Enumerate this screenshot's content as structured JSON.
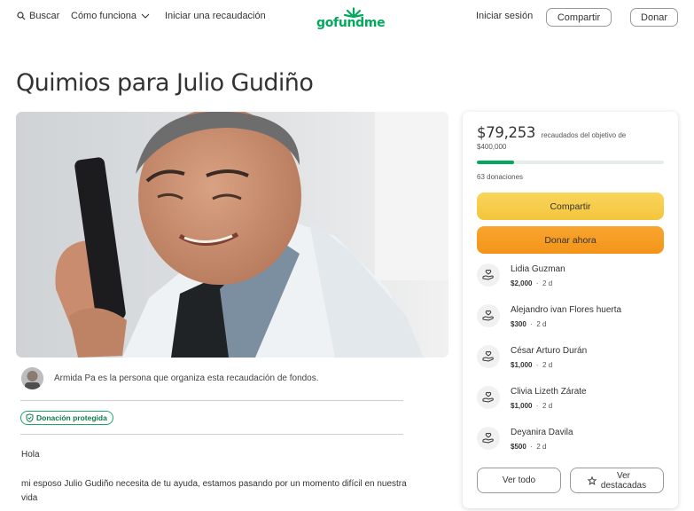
{
  "header": {
    "search_label": "Buscar",
    "how_label": "Cómo funciona",
    "start_label": "Iniciar una recaudación",
    "logo_text": "gofundme",
    "login_label": "Iniciar sesión",
    "share_label": "Compartir",
    "donate_label": "Donar"
  },
  "campaign": {
    "title": "Quimios para Julio Gudiño",
    "organizer_text": "Armida Pa es la persona que organiza esta recaudación de fondos.",
    "badge_label": "Donación protegida",
    "story": [
      "Hola",
      "mi esposo Julio Gudiño necesita de tu ayuda, estamos pasando por un momento difícil en nuestra vida"
    ]
  },
  "card": {
    "raised_amount": "$79,253",
    "raised_label": "recaudados del objetivo de",
    "goal": "$400,000",
    "progress_fraction": 0.198,
    "donations_count": "63 donaciones",
    "share_label": "Compartir",
    "donate_label": "Donar ahora",
    "donors": [
      {
        "name": "Lidia Guzman",
        "amount": "$2,000",
        "time": "2 d"
      },
      {
        "name": "Alejandro ivan Flores huerta",
        "amount": "$300",
        "time": "2 d"
      },
      {
        "name": "César Arturo Durán",
        "amount": "$1,000",
        "time": "2 d"
      },
      {
        "name": "Clivia Lizeth Zárate",
        "amount": "$1,000",
        "time": "2 d"
      },
      {
        "name": "Deyanira Davila",
        "amount": "$500",
        "time": "2 d"
      }
    ],
    "see_all_label": "Ver todo",
    "see_top_label_1": "Ver",
    "see_top_label_2": "destacadas"
  },
  "colors": {
    "brand_green": "#02a95c",
    "share_yellow": "#f4c53d",
    "donate_orange": "#f39419"
  }
}
